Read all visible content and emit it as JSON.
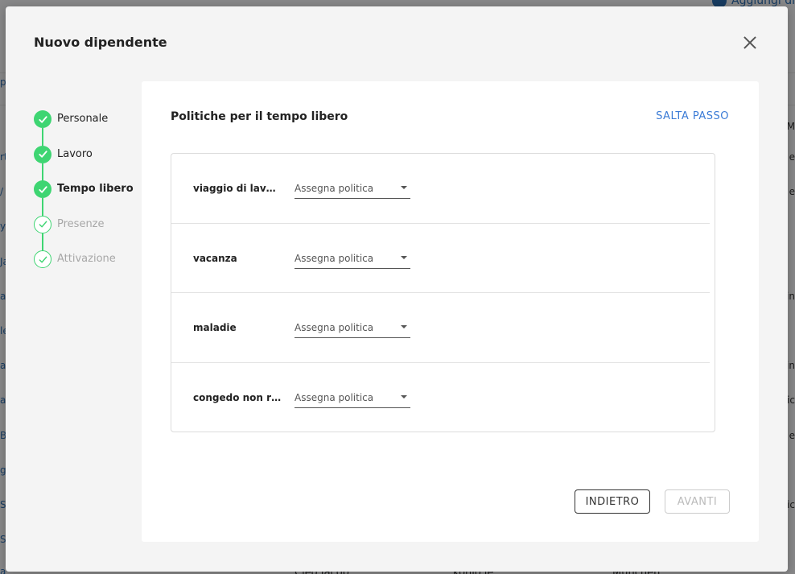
{
  "background": {
    "top_right_link": "Aggiungi di",
    "left_fragments": [
      "p",
      "rt",
      "/",
      "y",
      "Ja",
      "a",
      "le",
      "ar",
      "ar",
      "B",
      "gi",
      "S",
      "S",
      "a"
    ],
    "right_fragments": [
      "IM",
      "e",
      "e",
      "tin",
      "tin",
      "tic",
      "e",
      "tic"
    ],
    "bottom_texts": [
      "Cleo Jacob",
      "konio.ie",
      "Munchen"
    ]
  },
  "modal": {
    "title": "Nuovo dipendente",
    "close_label": "×"
  },
  "stepper": {
    "steps": [
      {
        "label": "Personale",
        "state": "done"
      },
      {
        "label": "Lavoro",
        "state": "done"
      },
      {
        "label": "Tempo libero",
        "state": "current"
      },
      {
        "label": "Presenze",
        "state": "pending"
      },
      {
        "label": "Attivazione",
        "state": "pending"
      }
    ]
  },
  "content": {
    "title": "Politiche per il tempo libero",
    "skip_label": "SALTA PASSO",
    "policies": [
      {
        "name": "viaggio di lavoro",
        "value": "Assegna politica"
      },
      {
        "name": "vacanza",
        "value": "Assegna politica"
      },
      {
        "name": "maladie",
        "value": "Assegna politica"
      },
      {
        "name": "congedo non retribuito",
        "value": "Assegna politica"
      }
    ],
    "back_label": "INDIETRO",
    "next_label": "AVANTI"
  },
  "colors": {
    "accent_green": "#3ed572",
    "link_blue": "#3b7bd6"
  }
}
